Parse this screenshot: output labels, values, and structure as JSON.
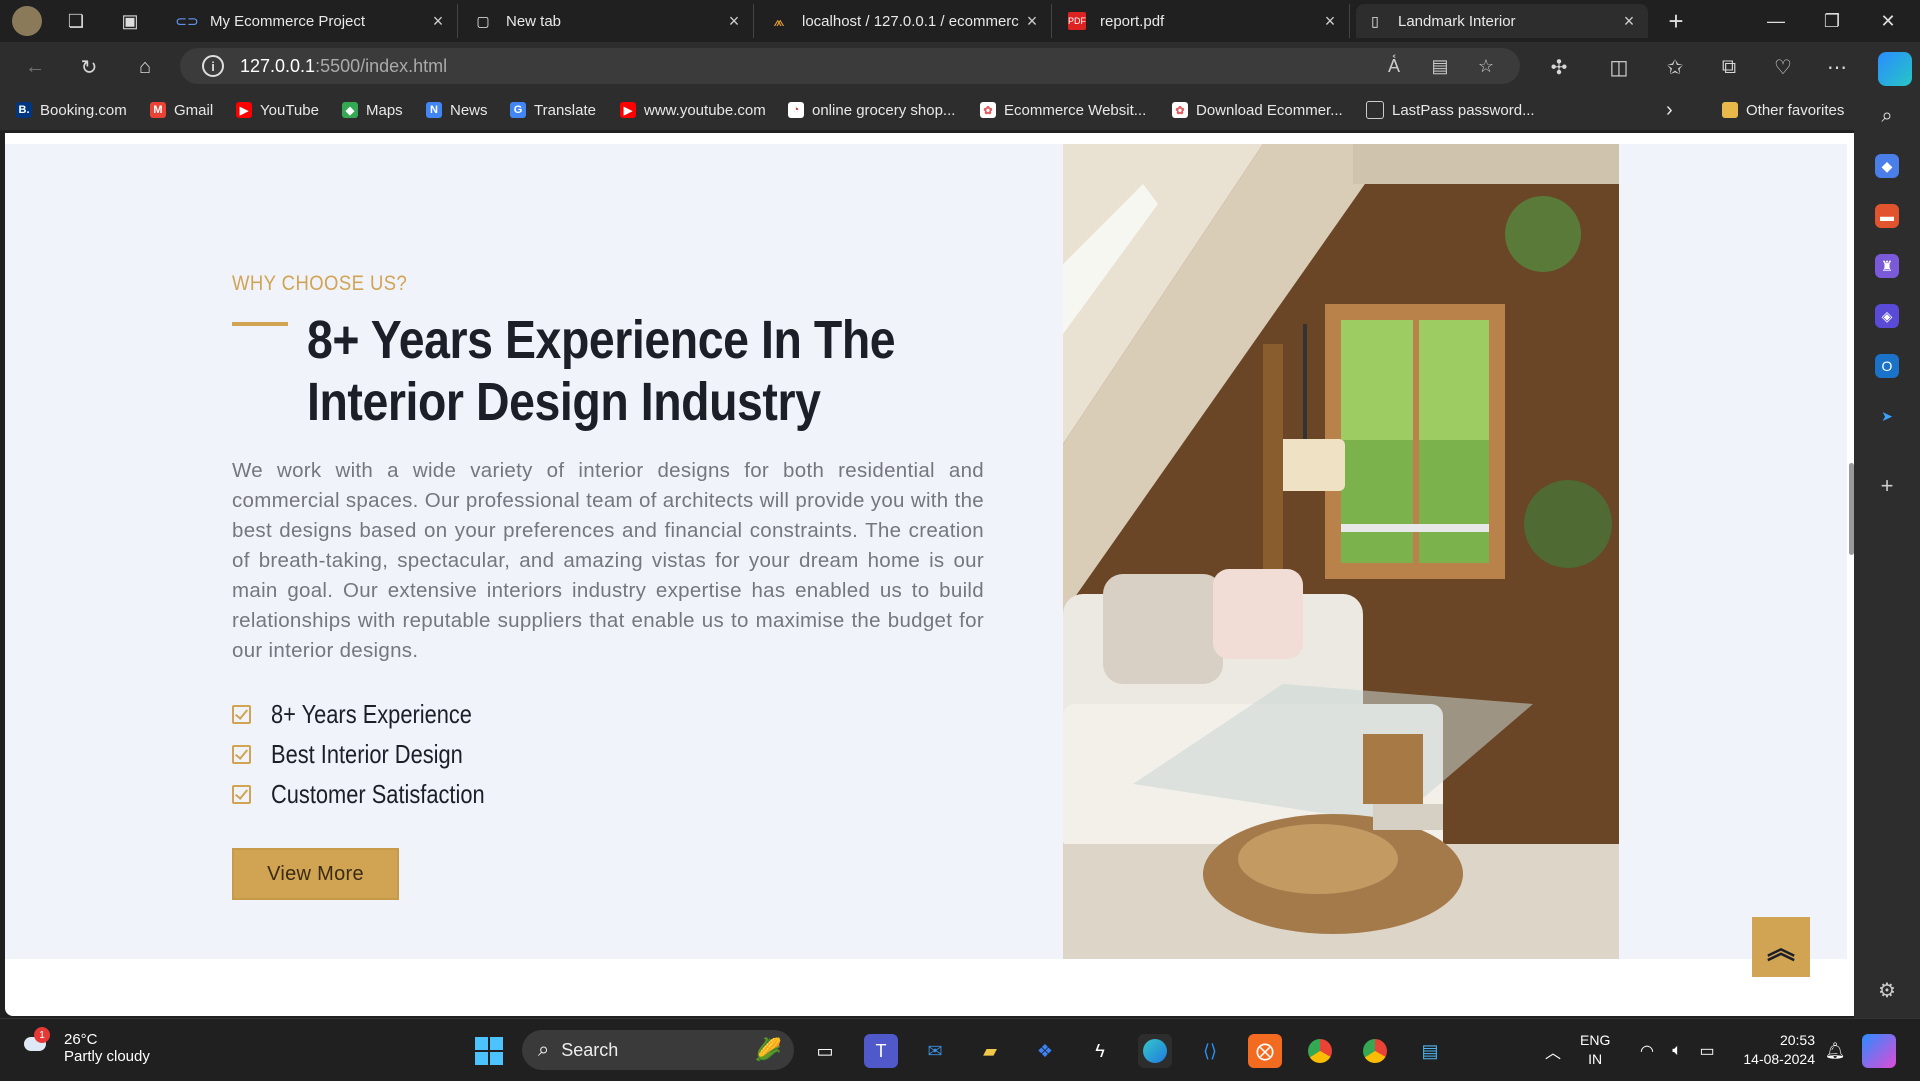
{
  "browser": {
    "tabs": [
      {
        "title": "My Ecommerce Project",
        "icon": "copilot-link-icon"
      },
      {
        "title": "New tab",
        "icon": "new-tab-icon"
      },
      {
        "title": "localhost / 127.0.0.1 / ecommerc",
        "icon": "phpmyadmin-icon"
      },
      {
        "title": "report.pdf",
        "icon": "pdf-icon"
      },
      {
        "title": "Landmark Interior",
        "icon": "page-icon",
        "active": true
      }
    ],
    "address": {
      "host": "127.0.0.1",
      "path": ":5500/index.html"
    },
    "bookmarks": [
      {
        "label": "Booking.com",
        "color": "#003580",
        "glyph": "B."
      },
      {
        "label": "Gmail",
        "color": "#ea4335",
        "glyph": "M"
      },
      {
        "label": "YouTube",
        "color": "#ff0000",
        "glyph": "▶"
      },
      {
        "label": "Maps",
        "color": "#34a853",
        "glyph": "◆"
      },
      {
        "label": "News",
        "color": "#4285f4",
        "glyph": "N"
      },
      {
        "label": "Translate",
        "color": "#4285f4",
        "glyph": "G"
      },
      {
        "label": "www.youtube.com",
        "color": "#ff0000",
        "glyph": "▶"
      },
      {
        "label": "online grocery shop...",
        "color": "#ffffff",
        "glyph": "◔"
      },
      {
        "label": "Ecommerce Websit...",
        "color": "#e25d5d",
        "glyph": "✿"
      },
      {
        "label": "Download Ecommer...",
        "color": "#e25d5d",
        "glyph": "✿"
      },
      {
        "label": "LastPass password...",
        "color": "#555555",
        "glyph": "▭"
      }
    ],
    "other_favorites": "Other favorites"
  },
  "page": {
    "eyebrow": "WHY CHOOSE US?",
    "heading_line1": "8+ Years Experience In The",
    "heading_line2": "Interior Design Industry",
    "paragraph": "We work with a wide variety of interior designs for both residential and commercial spaces. Our professional team of architects will provide you with the best designs based on your preferences and financial constraints. The creation of breath-taking, spectacular, and amazing vistas for your dream home is our main goal. Our extensive interiors industry expertise has enabled us to build relationships with reputable suppliers that enable us to maximise the budget for our interior designs.",
    "checklist": [
      "8+ Years Experience",
      "Best Interior Design",
      "Customer Satisfaction"
    ],
    "button": "View More",
    "accent_color": "#d1a454",
    "image": "interior-living-room-photo"
  },
  "taskbar": {
    "weather_temp": "26°C",
    "weather_desc": "Partly cloudy",
    "weather_badge": "1",
    "search_placeholder": "Search",
    "lang_line1": "ENG",
    "lang_line2": "IN",
    "time": "20:53",
    "date": "14-08-2024"
  }
}
